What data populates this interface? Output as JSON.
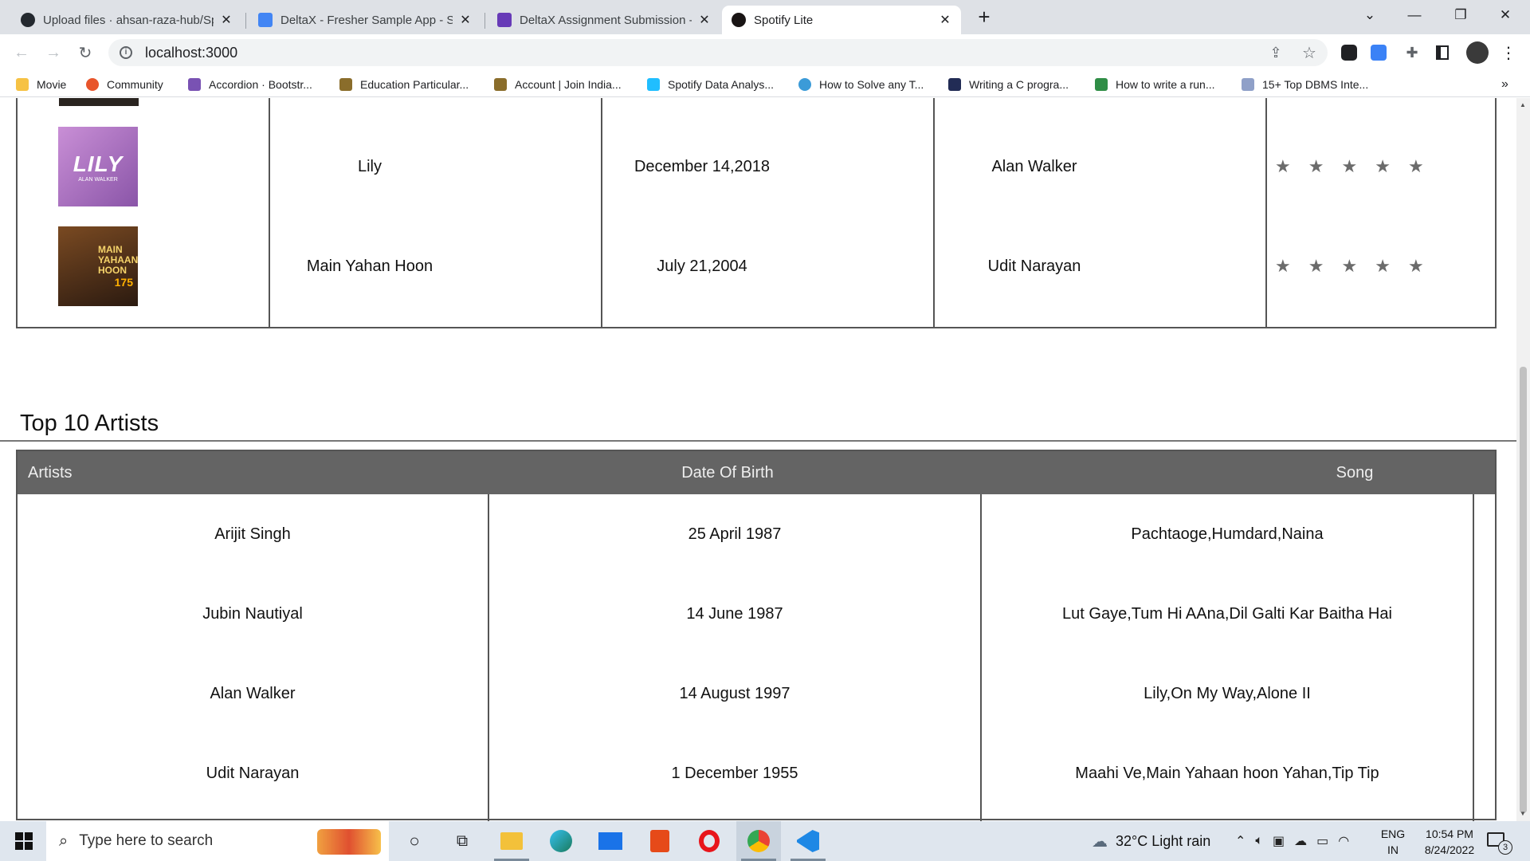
{
  "browser": {
    "tabs": [
      {
        "title": "Upload files · ahsan-raza-hub/Sp",
        "icon": "github-icon",
        "close": "✕"
      },
      {
        "title": "DeltaX - Fresher Sample App - Sp",
        "icon": "docs-icon",
        "close": "✕"
      },
      {
        "title": "DeltaX Assignment Submission -",
        "icon": "forms-icon",
        "close": "✕"
      },
      {
        "title": "Spotify Lite",
        "icon": "spotify-icon",
        "close": "✕"
      }
    ],
    "new_tab": "+",
    "url": "localhost:3000",
    "bookmarks": [
      {
        "label": "Movie",
        "icon": "folder-icon",
        "color": "#f6c244"
      },
      {
        "label": "Community",
        "icon": "community-icon",
        "color": "#e8552b"
      },
      {
        "label": "Accordion · Bootstr...",
        "icon": "bootstrap-icon",
        "color": "#7952b3"
      },
      {
        "label": "Education Particular...",
        "icon": "emblem-icon",
        "color": "#8a6d2b"
      },
      {
        "label": "Account | Join India...",
        "icon": "emblem-icon",
        "color": "#8a6d2b"
      },
      {
        "label": "Spotify Data Analys...",
        "icon": "kaggle-icon",
        "color": "#20beff"
      },
      {
        "label": "How to Solve any T...",
        "icon": "medium-icon",
        "color": "#3b9bd8"
      },
      {
        "label": "Writing a C progra...",
        "icon": "hashnode-icon",
        "color": "#222c55"
      },
      {
        "label": "How to write a run...",
        "icon": "geeks-icon",
        "color": "#2f8d46"
      },
      {
        "label": "15+ Top DBMS Inte...",
        "icon": "site-icon",
        "color": "#8fa0c8"
      }
    ],
    "more_bookmarks": "»"
  },
  "songs_table": {
    "rows": [
      {
        "title": "Lily",
        "date": "December 14,2018",
        "artist": "Alan Walker",
        "rating": 5,
        "cover_text": "LILY",
        "cover_sub": "ALAN WALKER",
        "cover_color": "#b27bc4"
      },
      {
        "title": "Main Yahan Hoon",
        "date": "July 21,2004",
        "artist": "Udit Narayan",
        "rating": 5,
        "cover_text": "MAIN YAHAAN HOON",
        "cover_sub": "175",
        "cover_color": "#5a3418"
      }
    ],
    "star_glyph": "★"
  },
  "artists": {
    "heading": "Top 10 Artists",
    "columns": [
      "Artists",
      "Date Of Birth",
      "Song"
    ],
    "rows": [
      {
        "name": "Arijit Singh",
        "dob": "25 April 1987",
        "songs": "Pachtaoge,Humdard,Naina"
      },
      {
        "name": "Jubin Nautiyal",
        "dob": "14 June 1987",
        "songs": "Lut Gaye,Tum Hi AAna,Dil Galti Kar Baitha Hai"
      },
      {
        "name": "Alan Walker",
        "dob": "14 August 1997",
        "songs": "Lily,On My Way,Alone II"
      },
      {
        "name": "Udit Narayan",
        "dob": "1 December 1955",
        "songs": "Maahi Ve,Main Yahaan hoon Yahan,Tip Tip"
      }
    ]
  },
  "taskbar": {
    "search_placeholder": "Type here to search",
    "weather": "32°C  Light rain",
    "lang_top": "ENG",
    "lang_bottom": "IN",
    "time": "10:54 PM",
    "date": "8/24/2022",
    "notifications": "3"
  },
  "colors": {
    "header_bg": "#646464",
    "border": "#555555"
  }
}
